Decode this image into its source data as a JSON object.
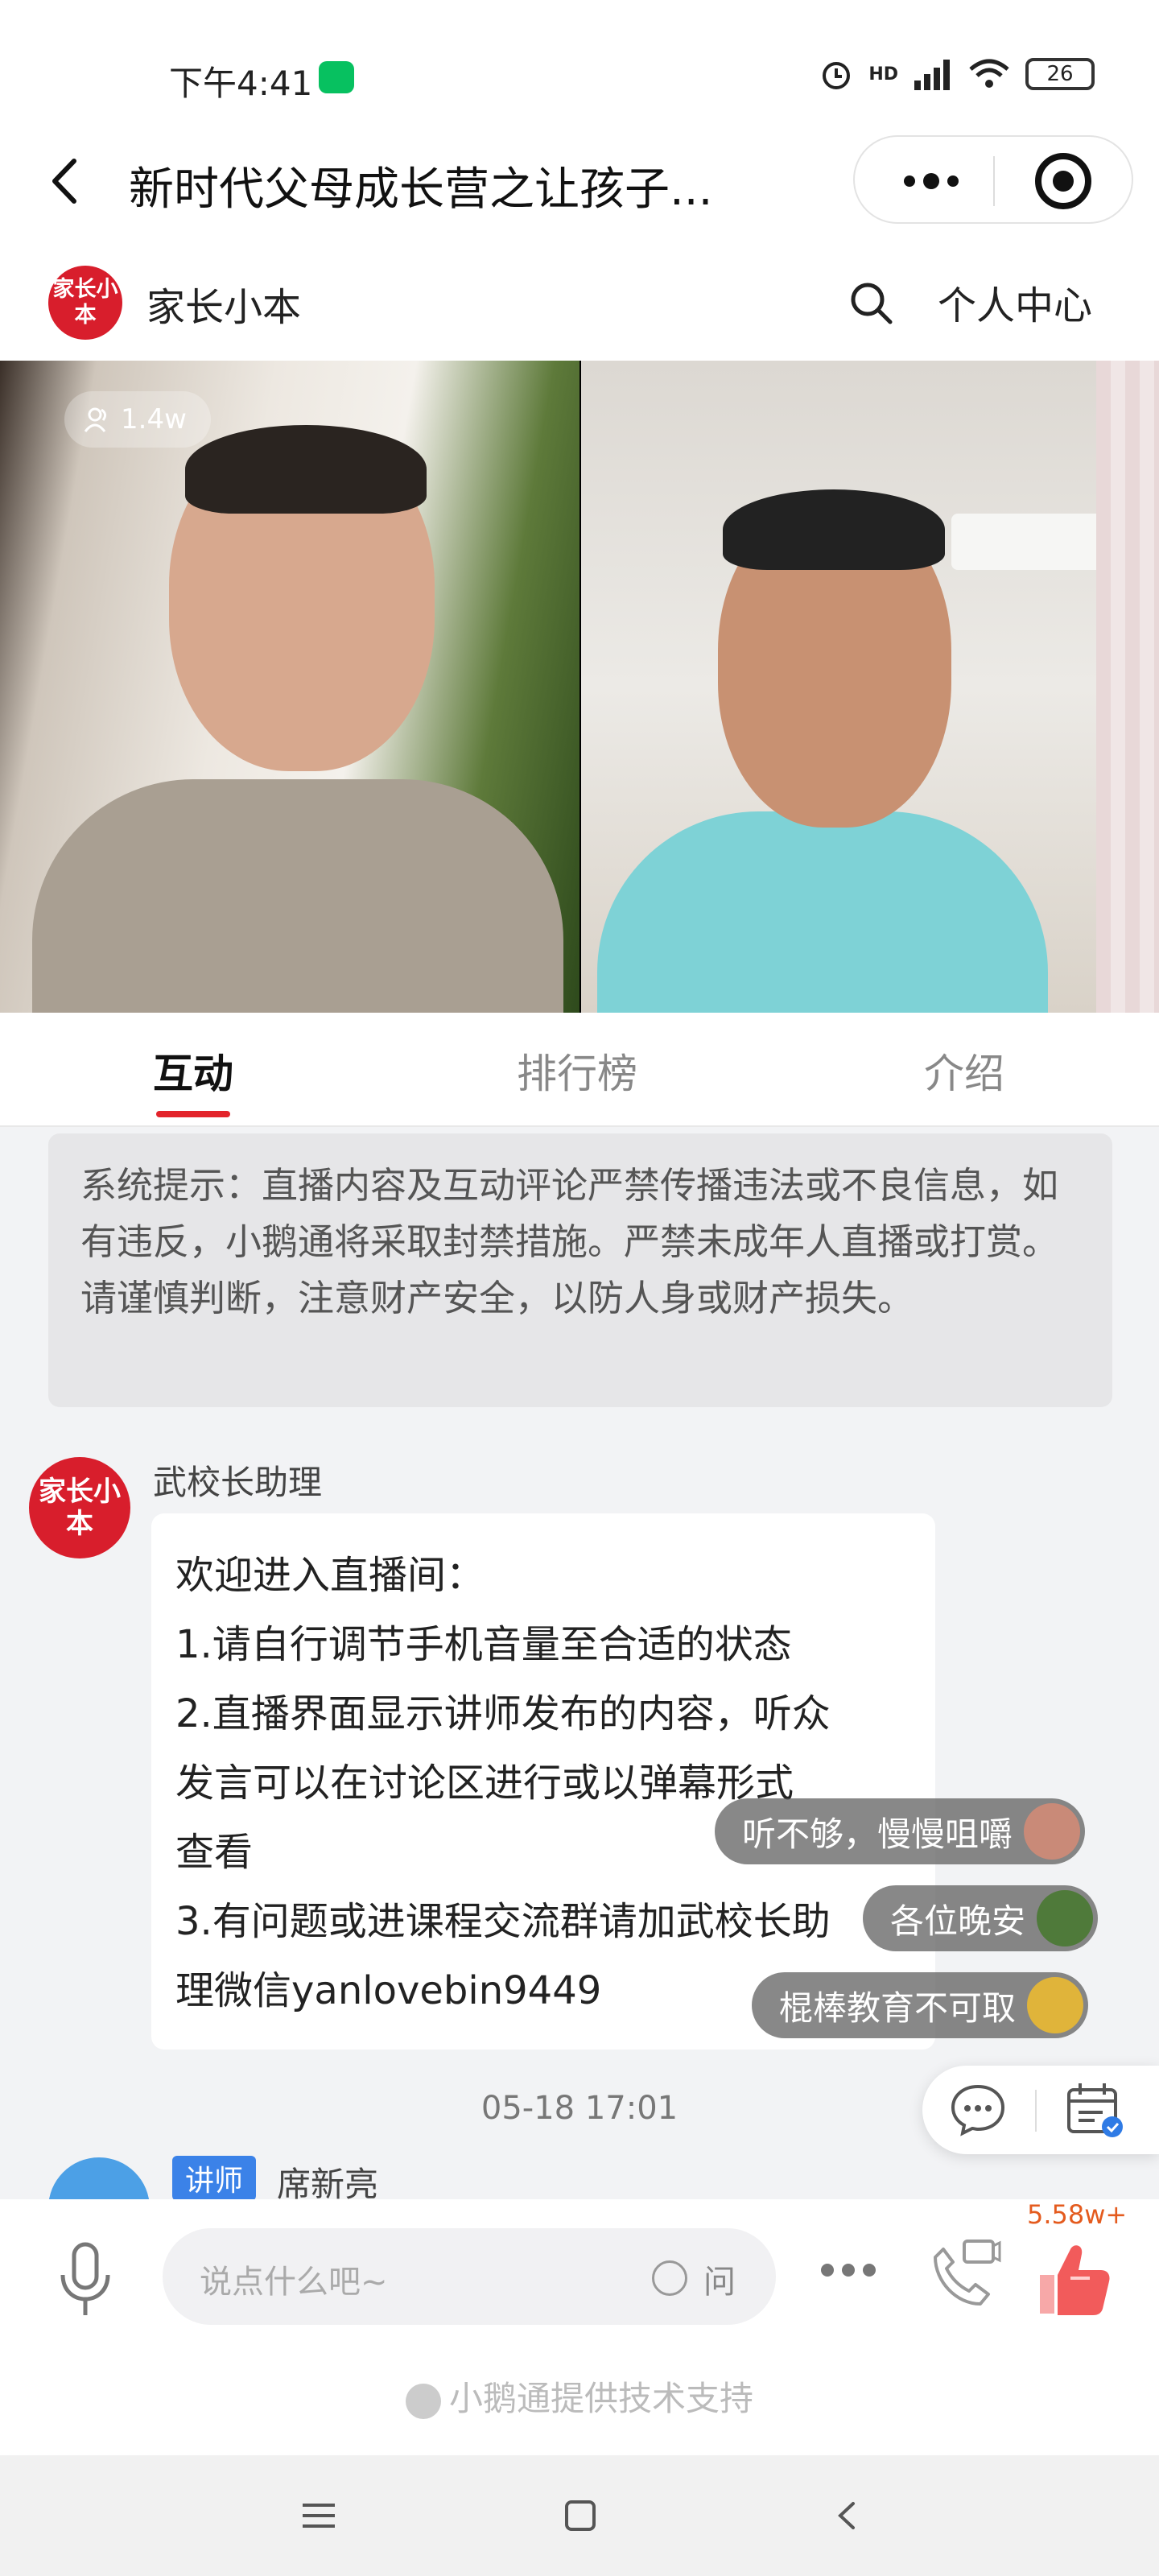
{
  "status_bar": {
    "time": "下午4:41",
    "network": "HD",
    "battery": "26"
  },
  "nav": {
    "title": "新时代父母成长营之让孩子..."
  },
  "shop": {
    "logo_text": "家长小本",
    "name": "家长小本",
    "user_center": "个人中心"
  },
  "video": {
    "viewers": "1.4w"
  },
  "tabs": [
    {
      "label": "互动",
      "active": true
    },
    {
      "label": "排行榜",
      "active": false
    },
    {
      "label": "介绍",
      "active": false
    }
  ],
  "notice": "系统提示：直播内容及互动评论严禁传播违法或不良信息，如有违反，小鹅通将采取封禁措施。严禁未成年人直播或打赏。请谨慎判断，注意财产安全，以防人身或财产损失。",
  "message": {
    "avatar_text": "家长小本",
    "sender": "武校长助理",
    "lines": [
      "欢迎进入直播间：",
      "1.请自行调节手机音量至合适的状态",
      "2.直播界面显示讲师发布的内容，听众",
      "发言可以在讨论区进行或以弹幕形式",
      "查看",
      "3.有问题或进课程交流群请加武校长助",
      "理微信yanlovebin9449"
    ]
  },
  "danmaku": [
    {
      "text": "听不够，慢慢咀嚼",
      "avatar_color": "#c98a78"
    },
    {
      "text": "各位晚安",
      "avatar_color": "#4f7a3a"
    },
    {
      "text": "棍棒教育不可取",
      "avatar_color": "#e0b43a"
    }
  ],
  "timestamp": "05-18 17:01",
  "lecturer": {
    "badge": "讲师",
    "name": "席新亮"
  },
  "input": {
    "placeholder": "说点什么吧~",
    "ask_label": "问"
  },
  "likes": "5.58w+",
  "tech_support": "小鹅通提供技术支持",
  "colors": {
    "accent_red": "#e3242b",
    "brand_red": "#d81e2c",
    "lecturer_blue": "#3b82e8",
    "like_orange": "#e45b1e"
  }
}
